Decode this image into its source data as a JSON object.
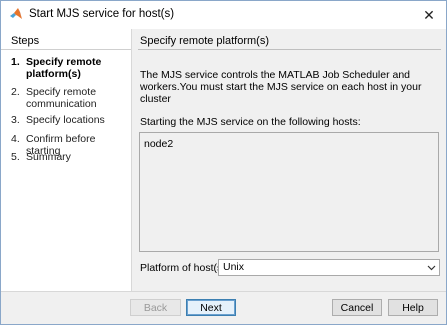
{
  "window": {
    "title": "Start MJS service for host(s)",
    "close_glyph": "✕"
  },
  "sidebar": {
    "title": "Steps",
    "steps": [
      {
        "num": "1.",
        "label": "Specify remote platform(s)",
        "active": true
      },
      {
        "num": "2.",
        "label": "Specify remote communication",
        "active": false
      },
      {
        "num": "3.",
        "label": "Specify locations",
        "active": false
      },
      {
        "num": "4.",
        "label": "Confirm before starting",
        "active": false
      },
      {
        "num": "5.",
        "label": "Summary",
        "active": false
      }
    ]
  },
  "main": {
    "header": "Specify remote platform(s)",
    "description": "The MJS service controls the MATLAB Job Scheduler and workers.You must start the MJS service on each host in your cluster",
    "hosts_label": "Starting the MJS service on the following hosts:",
    "hosts": [
      "node2"
    ],
    "platform_label": "Platform of host(s):",
    "platform_value": "Unix"
  },
  "footer": {
    "back_label": "Back",
    "next_label": "Next",
    "cancel_label": "Cancel",
    "help_label": "Help"
  },
  "icons": {
    "app": "matlab-icon",
    "close": "close-icon",
    "dropdown": "chevron-down-icon"
  }
}
